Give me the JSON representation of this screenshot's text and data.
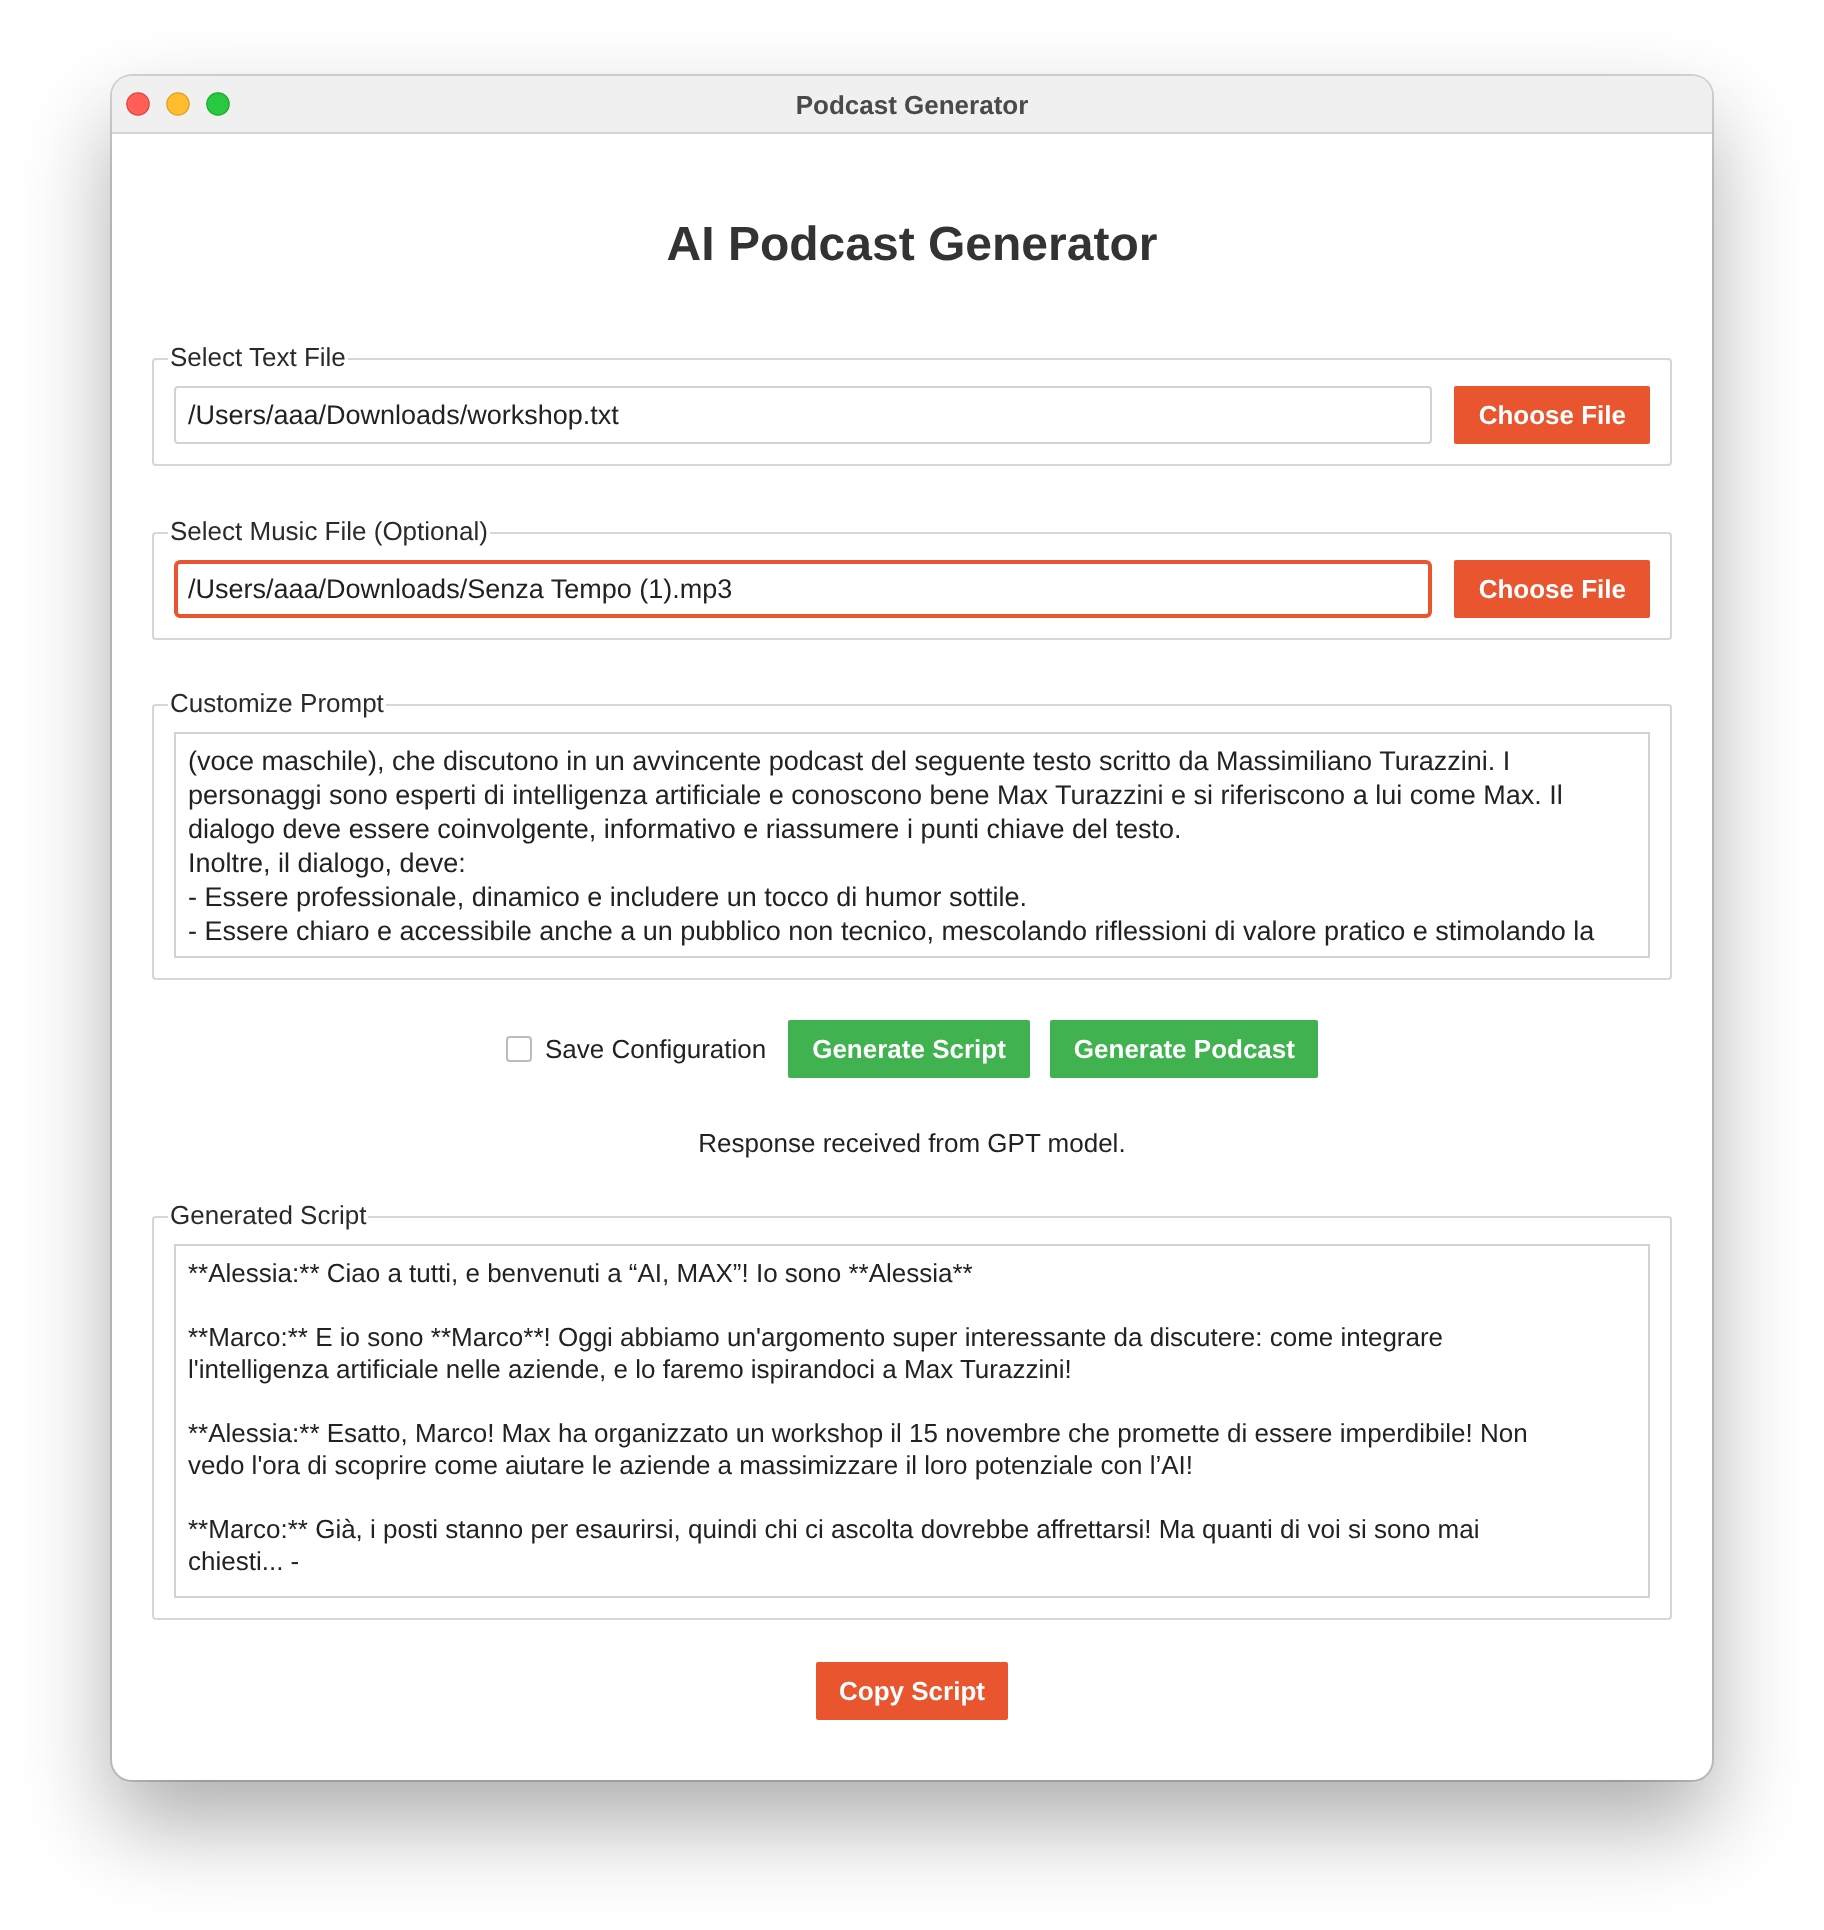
{
  "window": {
    "title": "Podcast Generator"
  },
  "heading": "AI Podcast Generator",
  "file_sections": [
    {
      "legend": "Select Text File",
      "value": "/Users/aaa/Downloads/workshop.txt",
      "focused": false,
      "button": "Choose File"
    },
    {
      "legend": "Select Music File (Optional)",
      "value": "/Users/aaa/Downloads/Senza Tempo (1).mp3",
      "focused": true,
      "button": "Choose File"
    }
  ],
  "prompt": {
    "legend": "Customize Prompt",
    "lines": [
      "(voce maschile), che discutono in un avvincente podcast del seguente testo scritto da Massimiliano Turazzini. I",
      "personaggi sono esperti di intelligenza artificiale e conoscono bene Max Turazzini e si riferiscono a lui come Max. Il",
      "dialogo deve essere coinvolgente, informativo e riassumere i punti chiave del testo.",
      "Inoltre, il dialogo, deve:",
      "- Essere professionale, dinamico e includere un tocco di humor sottile.",
      "- Essere chiaro e accessibile anche a un pubblico non tecnico, mescolando riflessioni di valore pratico e stimolando la"
    ]
  },
  "actions": {
    "save_configuration": {
      "label": "Save Configuration",
      "checked": false
    },
    "buttons": [
      {
        "label": "Generate Script"
      },
      {
        "label": "Generate Podcast"
      }
    ]
  },
  "status": "Response received from GPT model.",
  "script": {
    "legend": "Generated Script",
    "paragraphs": [
      [
        "**Alessia:** Ciao a tutti, e benvenuti a “AI, MAX”! Io sono **Alessia**"
      ],
      [
        "**Marco:** E io sono **Marco**! Oggi abbiamo un'argomento super interessante da discutere: come integrare",
        "l'intelligenza artificiale nelle aziende, e lo faremo ispirandoci a Max Turazzini!"
      ],
      [
        "**Alessia:** Esatto, Marco! Max ha organizzato un workshop il 15 novembre che promette di essere imperdibile! Non",
        "vedo l'ora di scoprire come aiutare le aziende a massimizzare il loro potenziale con l’AI!"
      ],
      [
        "**Marco:** Già, i posti stanno per esaurirsi, quindi chi ci ascolta dovrebbe affrettarsi! Ma quanti di voi si sono mai",
        "chiesti... -"
      ]
    ]
  },
  "copy_button": "Copy Script"
}
